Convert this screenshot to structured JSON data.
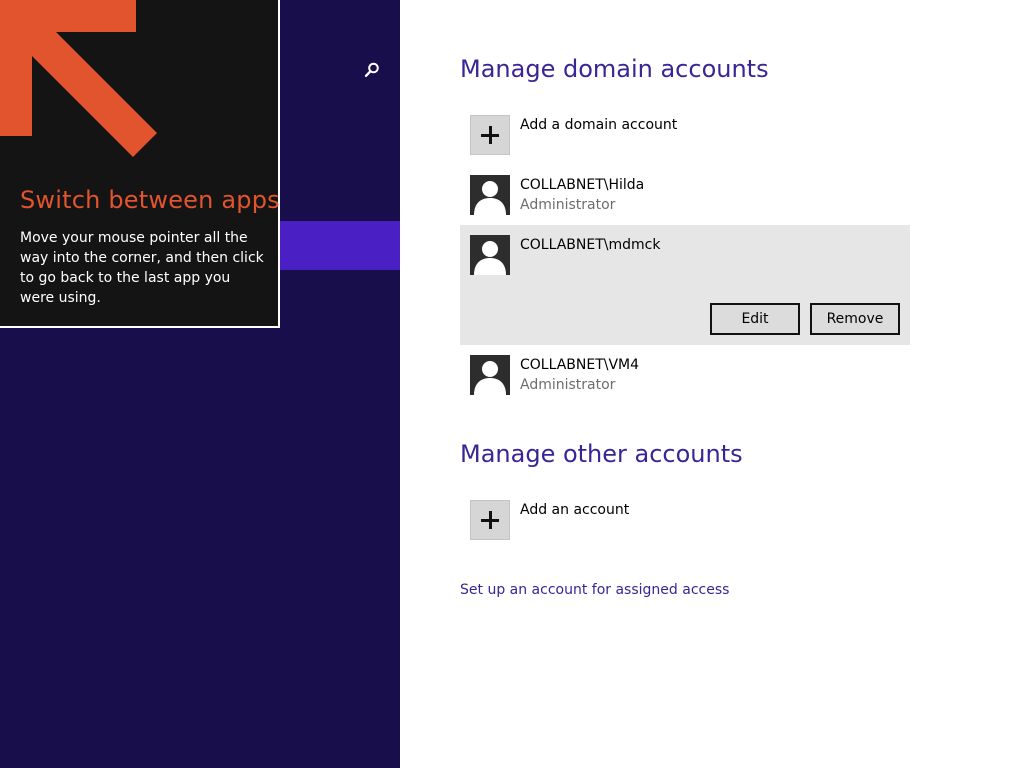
{
  "nav": {
    "search_icon": "search-icon"
  },
  "tip": {
    "title": "Switch between apps",
    "body": "Move your mouse pointer all the way into the corner, and then click to go back to the last app you were using.",
    "arrow_color": "#e2542d"
  },
  "domain_section": {
    "title": "Manage domain accounts",
    "add_label": "Add a domain account",
    "accounts": [
      {
        "name": "COLLABNET\\Hilda",
        "role": "Administrator"
      },
      {
        "name": "COLLABNET\\mdmck",
        "role": ""
      },
      {
        "name": "COLLABNET\\VM4",
        "role": "Administrator"
      }
    ],
    "edit_label": "Edit",
    "remove_label": "Remove"
  },
  "other_section": {
    "title": "Manage other accounts",
    "add_label": "Add an account"
  },
  "assigned_access_link": "Set up an account for assigned access",
  "colors": {
    "nav_background": "#180e4b",
    "nav_selected": "#4a1fc4",
    "heading": "#3a2596"
  }
}
